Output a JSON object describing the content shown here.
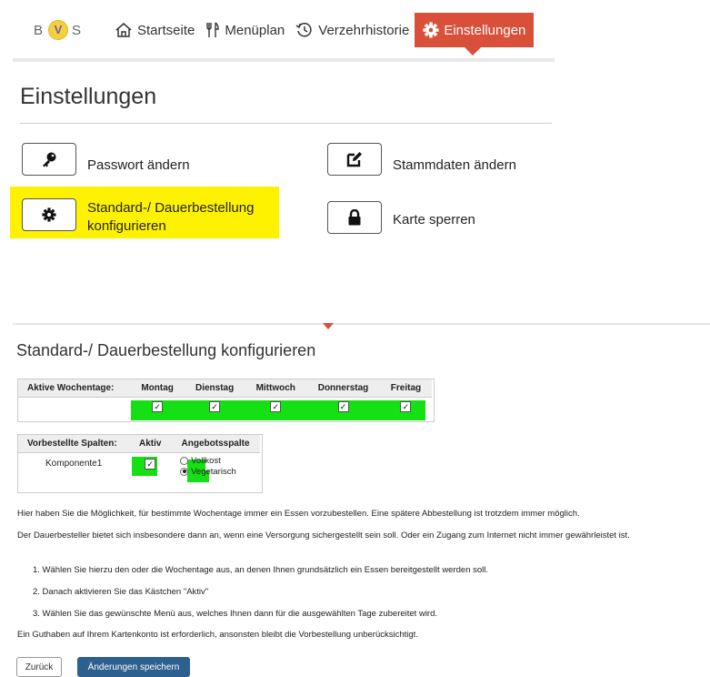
{
  "logo": {
    "left": "B",
    "mid": "V",
    "right": "S"
  },
  "nav": {
    "items": [
      {
        "label": "Startseite",
        "icon": "home-icon"
      },
      {
        "label": "Menüplan",
        "icon": "cutlery-icon"
      },
      {
        "label": "Verzehrhistorie",
        "icon": "history-icon"
      },
      {
        "label": "Einstellungen",
        "icon": "gear-icon",
        "active": true
      }
    ],
    "active_color": "#d9503a"
  },
  "settings": {
    "title": "Einstellungen",
    "buttons": {
      "password": "Passwort ändern",
      "stammdaten": "Stammdaten ändern",
      "standard_line1": "Standard-/ Dauerbestellung",
      "standard_line2": "konfigurieren",
      "card_block": "Karte sperren"
    },
    "highlight_color": "#fff200"
  },
  "config": {
    "title": "Standard-/ Dauerbestellung konfigurieren",
    "weekday_table": {
      "header": "Aktive Wochentage:",
      "days": [
        "Montag",
        "Dienstag",
        "Mittwoch",
        "Donnerstag",
        "Freitag"
      ],
      "checked": [
        true,
        true,
        true,
        true,
        true
      ]
    },
    "columns_table": {
      "headers": [
        "Vorbestellte Spalten:",
        "Aktiv",
        "Angebotsspalte"
      ],
      "row_label": "Komponente1",
      "aktiv": true,
      "options": [
        "Vollkost",
        "Vegetarisch"
      ],
      "selected": "Vegetarisch"
    },
    "highlight_color": "#14e014",
    "texts": {
      "p1": "Hier haben Sie die Möglichkeit, für bestimmte Wochentage immer ein Essen vorzubestellen. Eine spätere Abbestellung ist trotzdem immer möglich.",
      "p2": "Der Dauerbesteller bietet sich insbesondere dann an, wenn eine Versorgung sichergestellt sein soll. Oder ein Zugang zum Internet nicht immer gewährleistet ist.",
      "s1": "1. Wählen Sie hierzu den oder die Wochentage aus, an denen Ihnen grundsätzlich ein Essen bereitgestellt werden soll.",
      "s2": "2. Danach aktivieren Sie das Kästchen \"Aktiv\"",
      "s3": "3. Wählen Sie das gewünschte Menü aus, welches Ihnen dann für die ausgewählten Tage zubereitet wird.",
      "p3": "Ein Guthaben auf Ihrem Kartenkonto ist erforderlich, ansonsten bleibt die Vorbestellung unberücksichtigt."
    },
    "buttons": {
      "back": "Zurück",
      "save": "Änderungen speichern",
      "save_color": "#2d5f8f"
    }
  }
}
